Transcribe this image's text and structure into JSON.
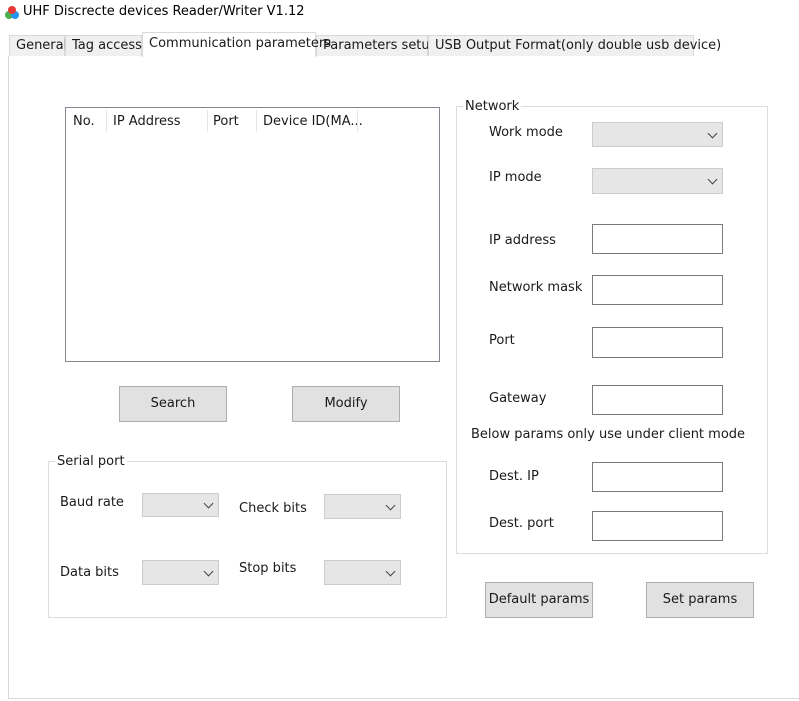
{
  "window": {
    "title": "UHF Discrecte devices Reader/Writer V1.12"
  },
  "tabs": [
    {
      "label": "General"
    },
    {
      "label": "Tag access"
    },
    {
      "label": "Communication parameters"
    },
    {
      "label": "Parameters setup"
    },
    {
      "label": "USB Output Format(only double usb device)"
    }
  ],
  "active_tab": "Communication parameters",
  "device_list": {
    "columns": [
      "No.",
      "IP Address",
      "Port",
      "Device ID(MA..."
    ],
    "rows": []
  },
  "buttons": {
    "search": "Search",
    "modify": "Modify",
    "default_params": "Default params",
    "set_params": "Set params"
  },
  "serial_port": {
    "title": "Serial port",
    "baud_rate_label": "Baud rate",
    "check_bits_label": "Check bits",
    "data_bits_label": "Data bits",
    "stop_bits_label": "Stop bits",
    "baud_rate_value": "",
    "check_bits_value": "",
    "data_bits_value": "",
    "stop_bits_value": ""
  },
  "network": {
    "title": "Network",
    "work_mode_label": "Work mode",
    "ip_mode_label": "IP mode",
    "ip_address_label": "IP address",
    "network_mask_label": "Network mask",
    "port_label": "Port",
    "gateway_label": "Gateway",
    "client_note": "Below params only use under client mode",
    "dest_ip_label": "Dest. IP",
    "dest_port_label": "Dest. port",
    "work_mode_value": "",
    "ip_mode_value": "",
    "ip_address_value": "",
    "network_mask_value": "",
    "port_value": "",
    "gateway_value": "",
    "dest_ip_value": "",
    "dest_port_value": ""
  },
  "colors": {
    "button_face": "#e1e1e1",
    "combo_face": "#e6e6e6",
    "tab_inactive": "#f0f0f0"
  }
}
